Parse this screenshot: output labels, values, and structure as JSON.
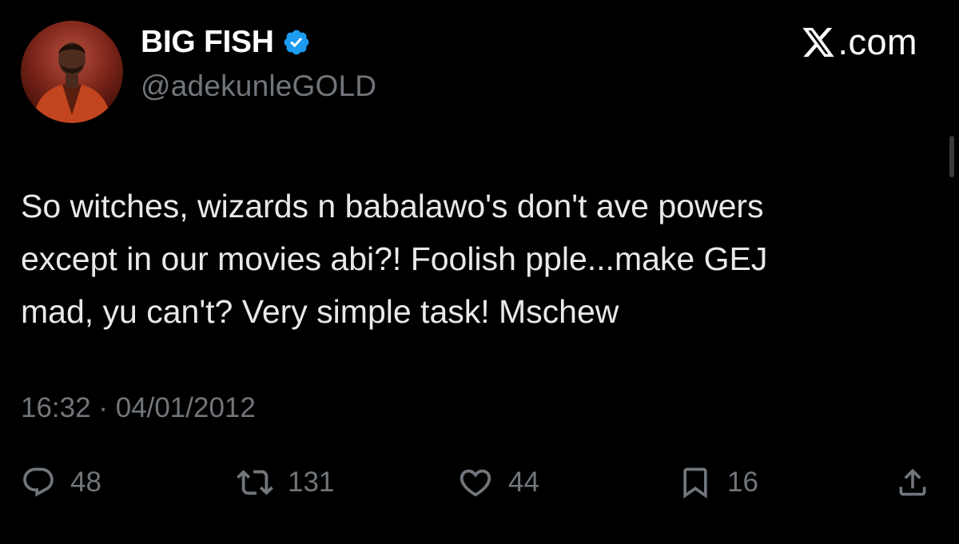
{
  "author": {
    "display_name": "BIG FISH",
    "handle": "@adekunleGOLD",
    "verified": true
  },
  "brand": {
    "logo_text": ".com",
    "logo_icon": "x-logo-icon"
  },
  "tweet": {
    "text_lines": [
      "So witches, wizards n babalawo's don't ave powers",
      "except in our movies abi?! Foolish pple...make GEJ",
      "mad, yu can't? Very simple task! Mschew"
    ],
    "timestamp": "16:32 · 04/01/2012"
  },
  "actions": {
    "reply": {
      "icon": "reply-icon",
      "count": "48"
    },
    "repost": {
      "icon": "repost-icon",
      "count": "131"
    },
    "like": {
      "icon": "heart-icon",
      "count": "44"
    },
    "bookmark": {
      "icon": "bookmark-icon",
      "count": "16"
    },
    "share": {
      "icon": "share-icon"
    }
  },
  "colors": {
    "background": "#000000",
    "primary_text": "#e7e9ea",
    "secondary_text": "#71767b",
    "verified_badge": "#1d9bf0"
  }
}
